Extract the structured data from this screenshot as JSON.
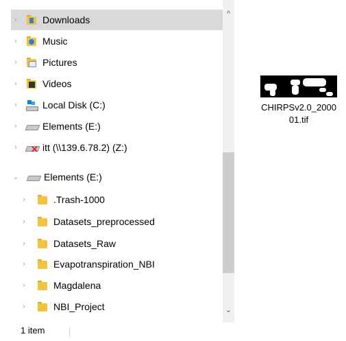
{
  "nav": {
    "items": [
      {
        "label": "Downloads",
        "icon": "downloads-folder-icon",
        "selected": true
      },
      {
        "label": "Music",
        "icon": "music-folder-icon"
      },
      {
        "label": "Pictures",
        "icon": "pictures-folder-icon"
      },
      {
        "label": "Videos",
        "icon": "videos-folder-icon"
      },
      {
        "label": "Local Disk (C:)",
        "icon": "local-disk-icon"
      },
      {
        "label": "Elements (E:)",
        "icon": "drive-icon"
      },
      {
        "label": "itt (\\\\139.6.78.2) (Z:)",
        "icon": "disconnected-network-drive-icon"
      }
    ],
    "drive": {
      "label": "Elements (E:)",
      "expanded": true
    },
    "subfolders": [
      {
        "label": ".Trash-1000"
      },
      {
        "label": "Datasets_preprocessed"
      },
      {
        "label": "Datasets_Raw"
      },
      {
        "label": "Evapotranspiration_NBI"
      },
      {
        "label": "Magdalena"
      },
      {
        "label": "NBI_Project"
      }
    ]
  },
  "scrollbar": {
    "up_arrow": "^",
    "down_arrow": "⌄"
  },
  "file": {
    "name_line1": "CHIRPSv2.0_2000",
    "name_line2": "01.tif",
    "icon": "tif-thumbnail-icon"
  },
  "status": {
    "item_count": "1 item"
  },
  "colors": {
    "selected_row": "#d9d9d9",
    "folder": "#f0c440",
    "scroll_thumb": "#cdcdcd"
  }
}
